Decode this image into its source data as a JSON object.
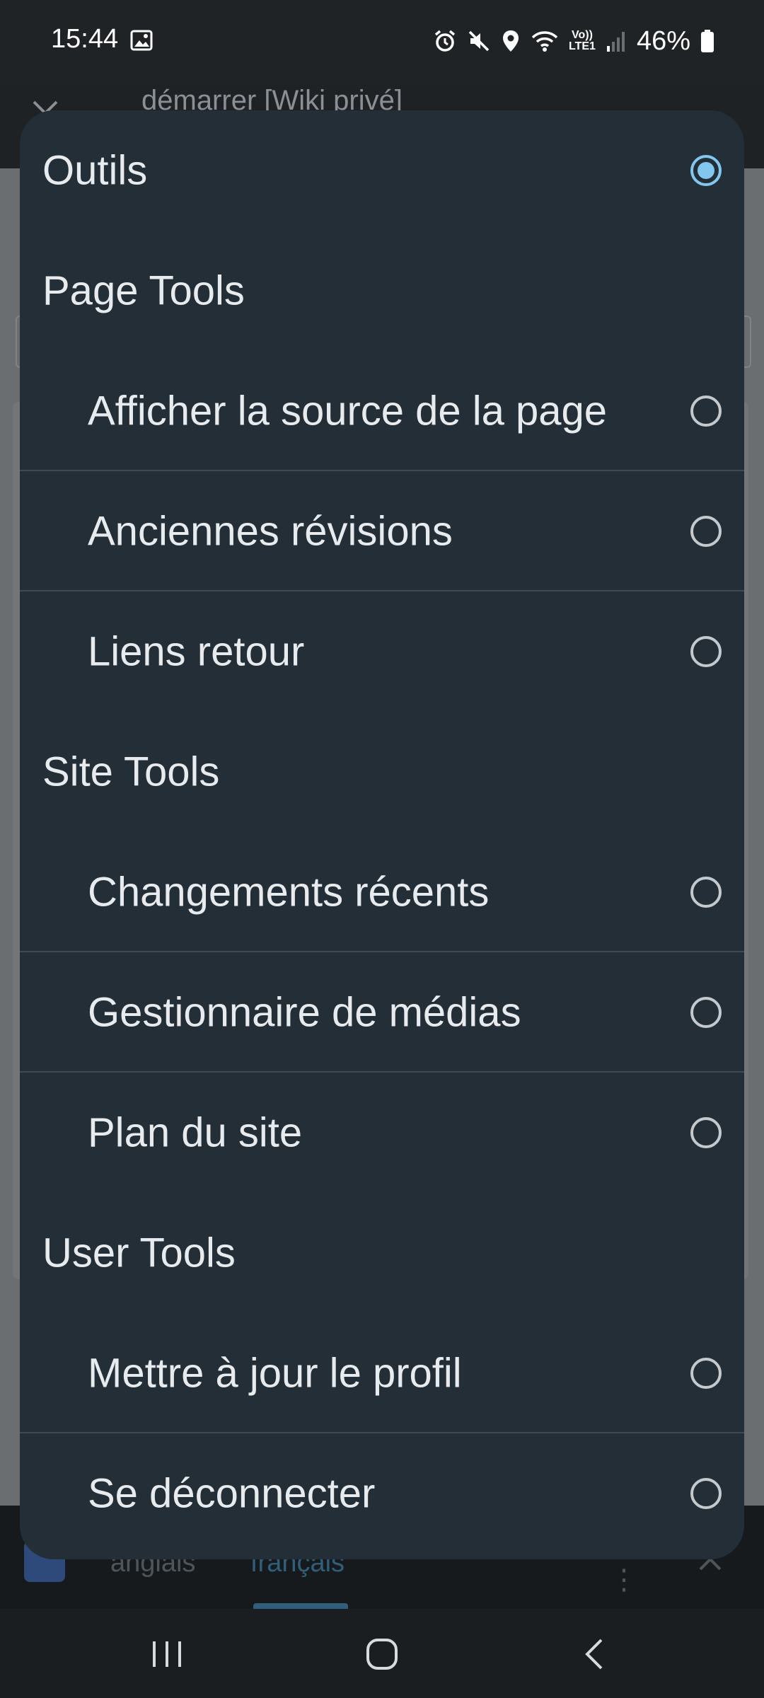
{
  "status_bar": {
    "time": "15:44",
    "battery": "46%",
    "network_label_top": "Vo))",
    "network_label_bottom": "LTE1",
    "icons": [
      "gallery-icon",
      "alarm-icon",
      "mute-icon",
      "location-icon",
      "wifi-icon",
      "signal-icon",
      "battery-icon"
    ]
  },
  "background_app": {
    "page_title": "démarrer [Wiki privé]",
    "translate_bar": {
      "source_lang": "anglais",
      "target_lang": "français"
    }
  },
  "dialog": {
    "items": [
      {
        "type": "top",
        "label": "Outils",
        "checked": true
      },
      {
        "type": "header",
        "label": "Page Tools"
      },
      {
        "type": "option",
        "label": "Afficher la source de la page",
        "checked": false
      },
      {
        "type": "option",
        "label": "Anciennes révisions",
        "checked": false
      },
      {
        "type": "option",
        "label": "Liens retour",
        "checked": false
      },
      {
        "type": "header",
        "label": "Site Tools"
      },
      {
        "type": "option",
        "label": "Changements récents",
        "checked": false
      },
      {
        "type": "option",
        "label": "Gestionnaire de médias",
        "checked": false
      },
      {
        "type": "option",
        "label": "Plan du site",
        "checked": false
      },
      {
        "type": "header",
        "label": "User Tools"
      },
      {
        "type": "option",
        "label": "Mettre à jour le profil",
        "checked": false
      },
      {
        "type": "option",
        "label": "Se déconnecter",
        "checked": false
      }
    ]
  },
  "colors": {
    "dialog_bg": "#232e36",
    "radio_selected": "#83c7f0",
    "text": "#e8ebed"
  }
}
